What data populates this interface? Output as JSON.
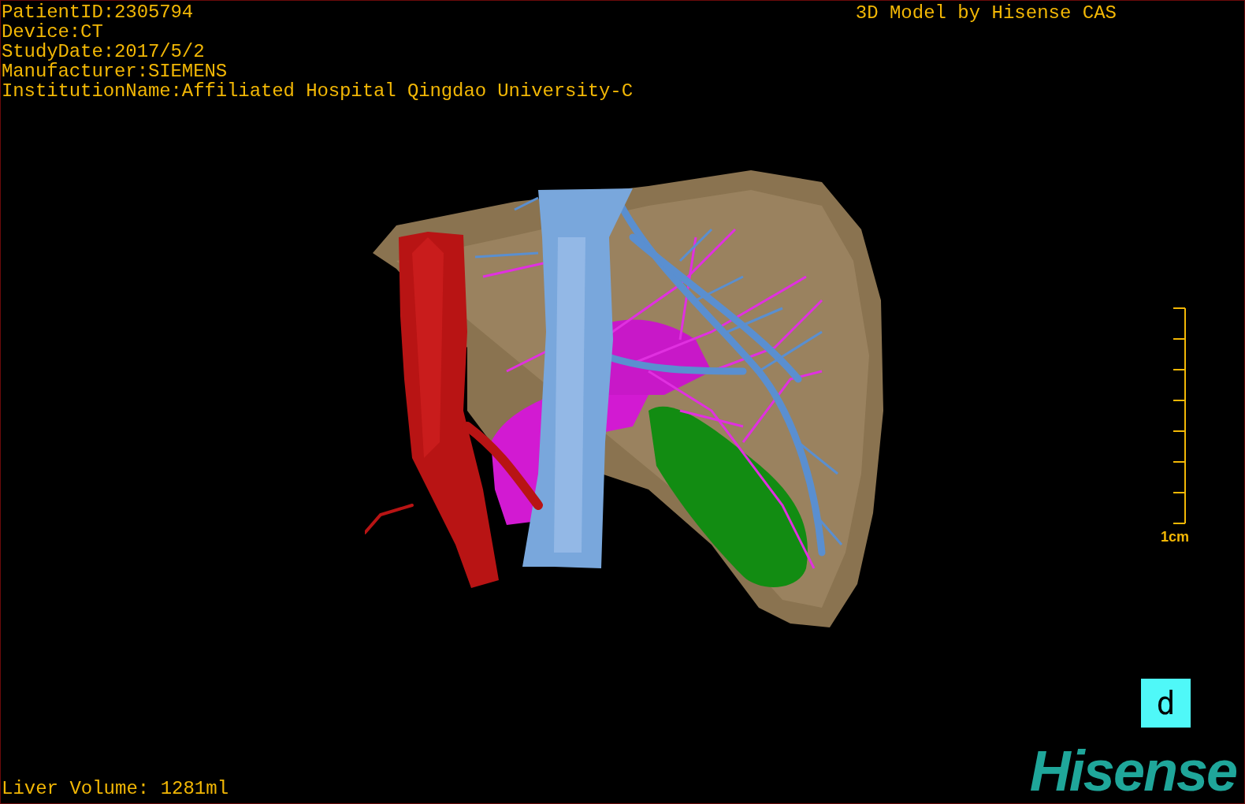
{
  "patient_info": [
    "PatientID:2305794",
    "Device:CT",
    "StudyDate:2017/5/2",
    "Manufacturer:SIEMENS",
    "InstitutionName:Affiliated Hospital Qingdao University-C"
  ],
  "title": "3D Model by Hisense CAS",
  "scale_bar": {
    "label": "1cm"
  },
  "view_button": {
    "label": "d"
  },
  "liver_volume": "Liver Volume: 1281ml",
  "logo": "Hisense"
}
